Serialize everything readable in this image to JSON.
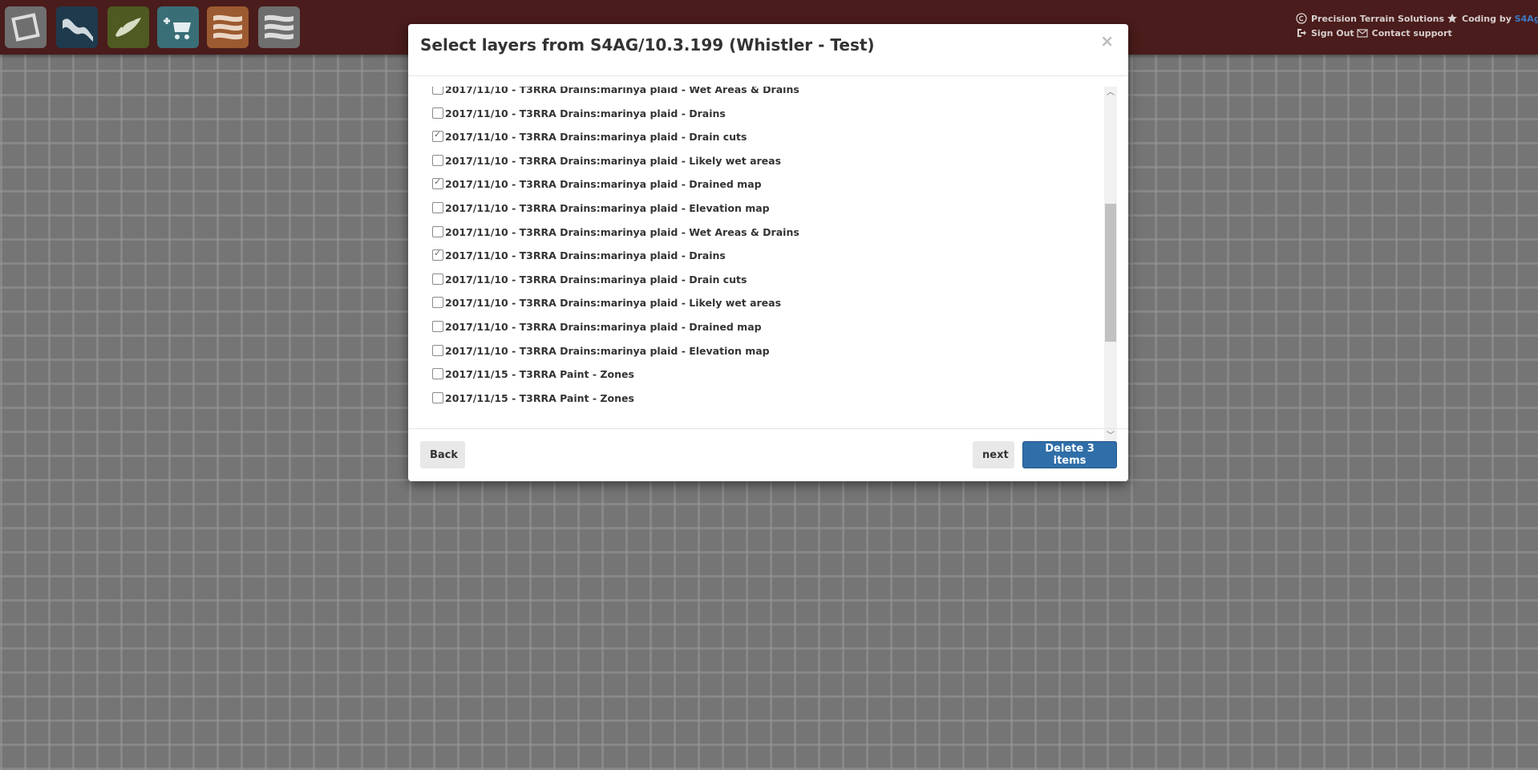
{
  "toolbar": {
    "tools": [
      {
        "icon": "select-area-icon",
        "color": "#6f6f6f"
      },
      {
        "icon": "wave-terrain-icon",
        "color": "#1f3a4d"
      },
      {
        "icon": "leaf-crop-icon",
        "color": "#4e5a22"
      },
      {
        "icon": "add-to-cart-icon",
        "color": "#3a6e77"
      },
      {
        "icon": "layers-orange-icon",
        "color": "#9c5a30"
      },
      {
        "icon": "layers-gray-icon",
        "color": "#6e6e6e"
      }
    ]
  },
  "credits": {
    "company": "Precision Terrain Solutions",
    "coding_by": "Coding by",
    "coding_by_link": "S4Ag",
    "sign_out": "Sign Out",
    "contact_support": "Contact support"
  },
  "modal": {
    "title": "Select layers from S4AG/10.3.199 (Whistler - Test)",
    "close_label": "×",
    "layers": [
      {
        "label": "2017/11/10 - T3RRA Drains:marinya plaid - Wet Areas & Drains",
        "checked": false
      },
      {
        "label": "2017/11/10 - T3RRA Drains:marinya plaid - Drains",
        "checked": false
      },
      {
        "label": "2017/11/10 - T3RRA Drains:marinya plaid - Drain cuts",
        "checked": true
      },
      {
        "label": "2017/11/10 - T3RRA Drains:marinya plaid - Likely wet areas",
        "checked": false
      },
      {
        "label": "2017/11/10 - T3RRA Drains:marinya plaid - Drained map",
        "checked": true
      },
      {
        "label": "2017/11/10 - T3RRA Drains:marinya plaid - Elevation map",
        "checked": false
      },
      {
        "label": "2017/11/10 - T3RRA Drains:marinya plaid - Wet Areas & Drains",
        "checked": false
      },
      {
        "label": "2017/11/10 - T3RRA Drains:marinya plaid - Drains",
        "checked": true
      },
      {
        "label": "2017/11/10 - T3RRA Drains:marinya plaid - Drain cuts",
        "checked": false
      },
      {
        "label": "2017/11/10 - T3RRA Drains:marinya plaid - Likely wet areas",
        "checked": false
      },
      {
        "label": "2017/11/10 - T3RRA Drains:marinya plaid - Drained map",
        "checked": false
      },
      {
        "label": "2017/11/10 - T3RRA Drains:marinya plaid - Elevation map",
        "checked": false
      },
      {
        "label": "2017/11/15 - T3RRA Paint - Zones",
        "checked": false
      },
      {
        "label": "2017/11/15 - T3RRA Paint - Zones",
        "checked": false
      }
    ],
    "back_label": "Back",
    "next_label": "next",
    "delete_label": "Delete 3 items"
  }
}
